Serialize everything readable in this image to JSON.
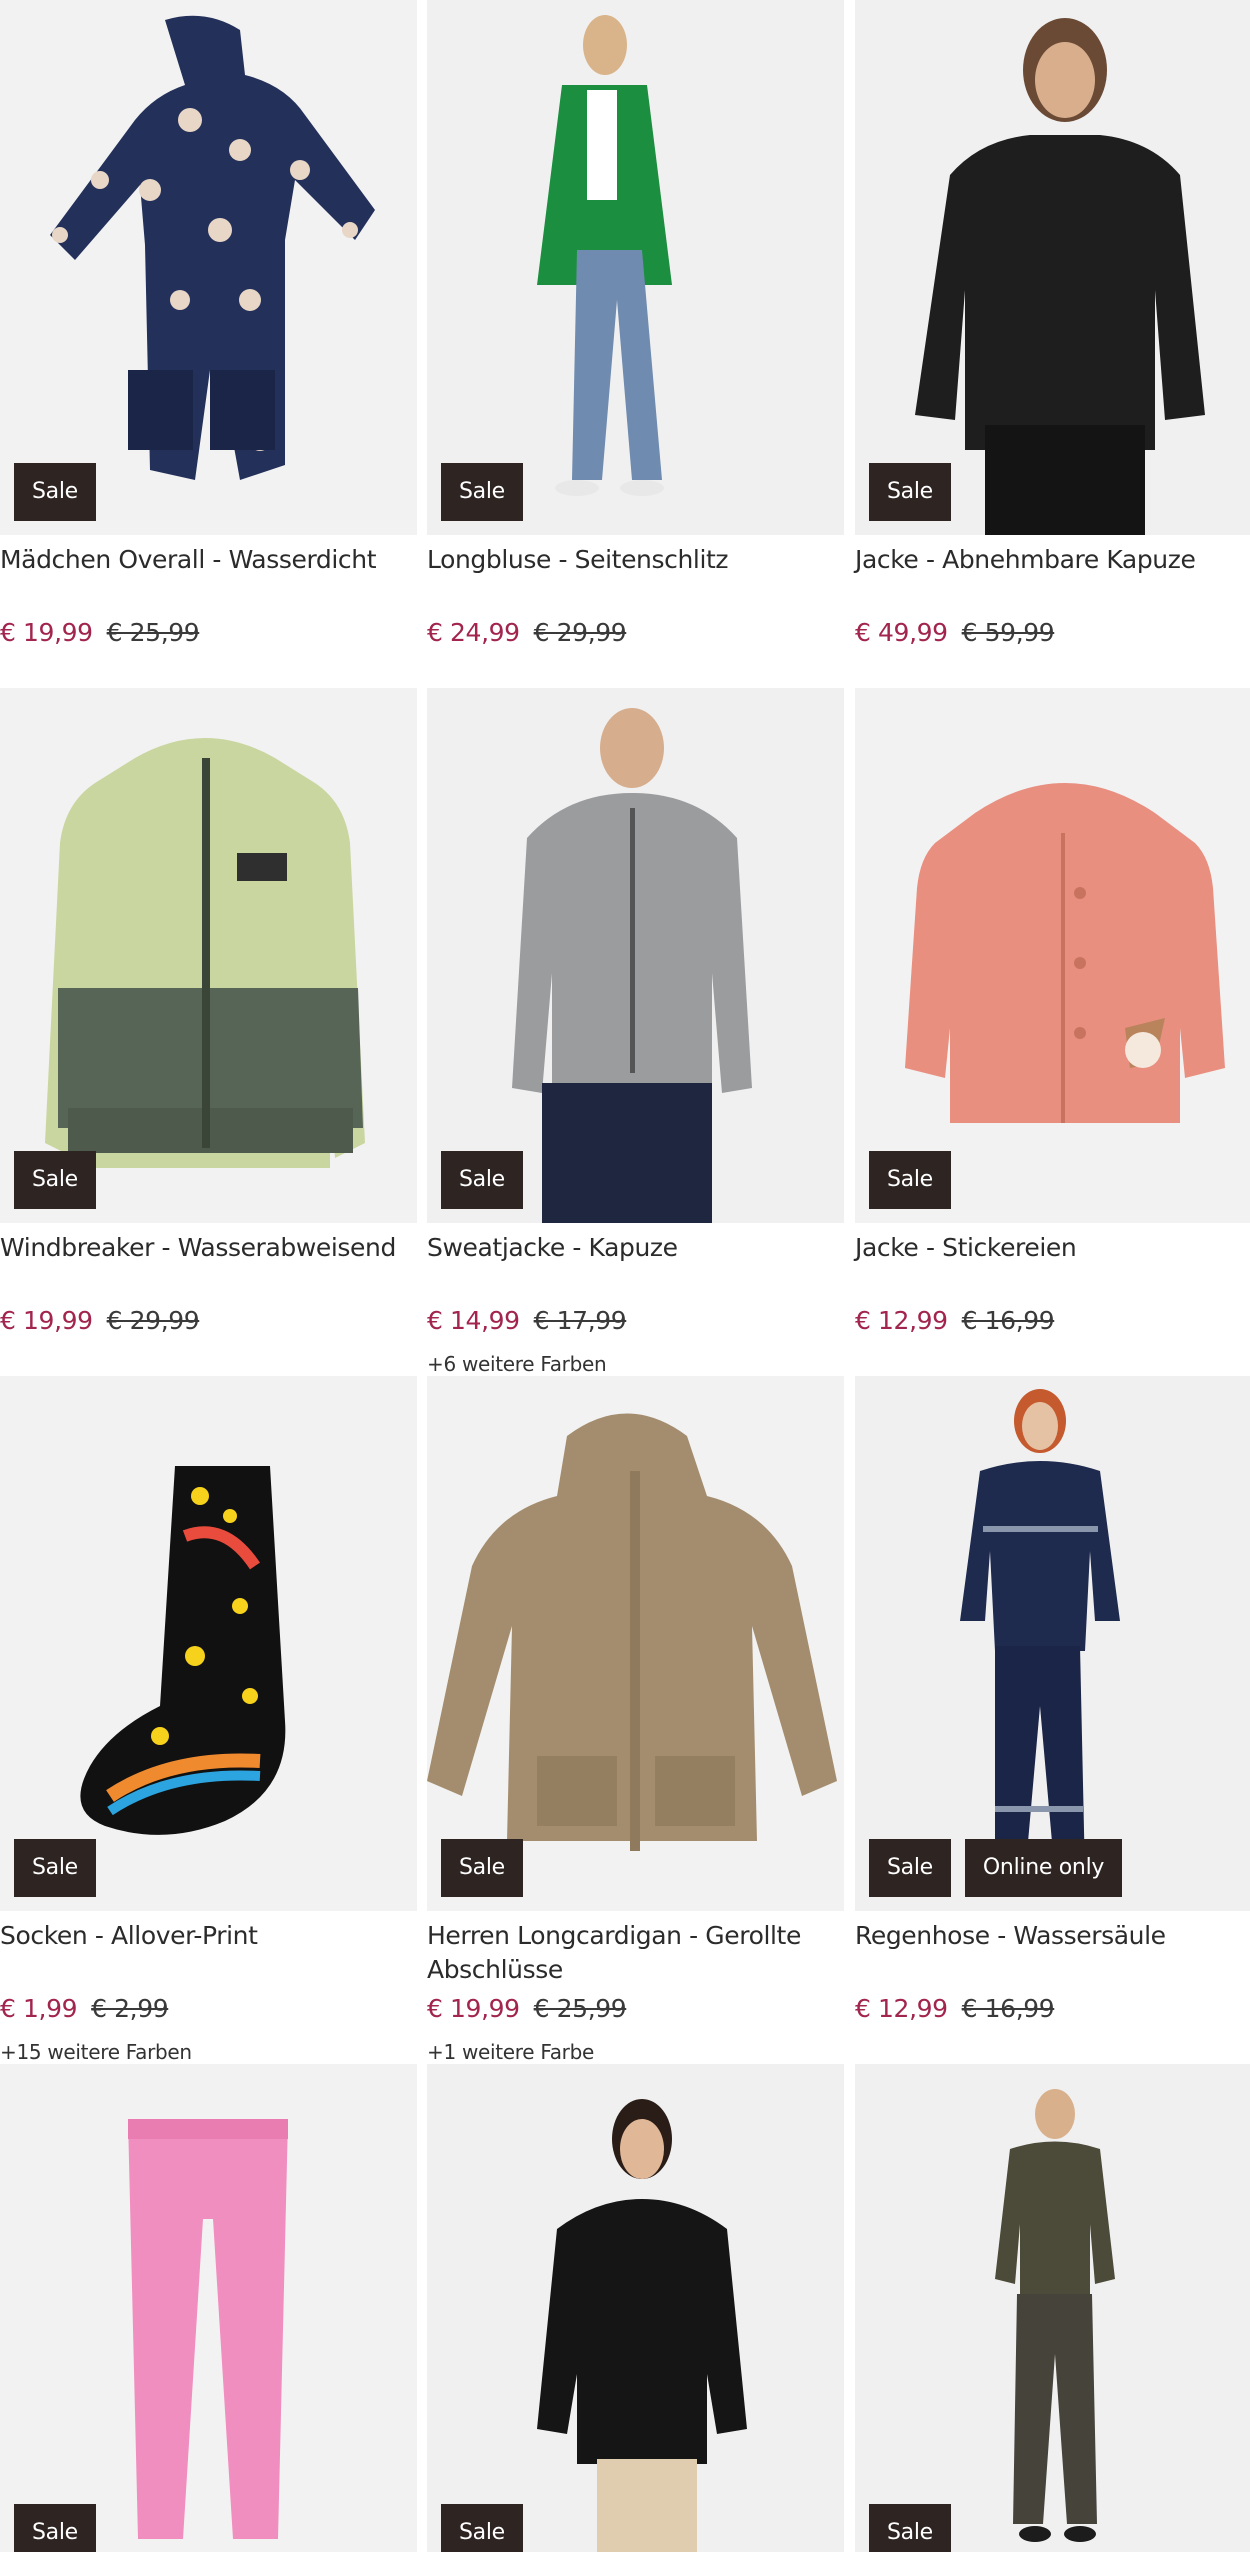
{
  "products": [
    {
      "title": "Mädchen Overall - Wasserdicht",
      "price": "€ 19,99",
      "old_price": "€ 25,99",
      "badges": [
        "Sale"
      ],
      "colors_text": "",
      "image_icon": "kids-overall-photo"
    },
    {
      "title": "Longbluse - Seitenschlitz",
      "price": "€ 24,99",
      "old_price": "€ 29,99",
      "badges": [
        "Sale"
      ],
      "colors_text": "",
      "image_icon": "model-green-blouse-photo"
    },
    {
      "title": "Jacke - Abnehmbare Kapuze",
      "price": "€ 49,99",
      "old_price": "€ 59,99",
      "badges": [
        "Sale"
      ],
      "colors_text": "",
      "image_icon": "model-black-jacket-photo"
    },
    {
      "title": "Windbreaker - Wasserabweisend",
      "price": "€ 19,99",
      "old_price": "€ 29,99",
      "badges": [
        "Sale"
      ],
      "colors_text": "",
      "image_icon": "windbreaker-photo"
    },
    {
      "title": "Sweatjacke - Kapuze",
      "price": "€ 14,99",
      "old_price": "€ 17,99",
      "badges": [
        "Sale"
      ],
      "colors_text": "+6 weitere Farben",
      "image_icon": "model-grey-hoodie-photo"
    },
    {
      "title": "Jacke - Stickereien",
      "price": "€ 12,99",
      "old_price": "€ 16,99",
      "badges": [
        "Sale"
      ],
      "colors_text": "",
      "image_icon": "baby-pink-knit-jacket-photo"
    },
    {
      "title": "Socken - Allover-Print",
      "price": "€ 1,99",
      "old_price": "€ 2,99",
      "badges": [
        "Sale"
      ],
      "colors_text": "+15 weitere Farben",
      "image_icon": "star-socks-photo"
    },
    {
      "title": "Herren Longcardigan - Gerollte Abschlüsse",
      "price": "€ 19,99",
      "old_price": "€ 25,99",
      "badges": [
        "Sale"
      ],
      "colors_text": "+1 weitere Farbe",
      "image_icon": "beige-cardigan-photo"
    },
    {
      "title": "Regenhose - Wassersäule",
      "price": "€ 12,99",
      "old_price": "€ 16,99",
      "badges": [
        "Sale",
        "Online only"
      ],
      "colors_text": "",
      "image_icon": "model-rainwear-photo"
    },
    {
      "title": "",
      "price": "",
      "old_price": "",
      "badges": [
        "Sale"
      ],
      "colors_text": "",
      "image_icon": "pink-leggings-photo"
    },
    {
      "title": "",
      "price": "",
      "old_price": "",
      "badges": [
        "Sale"
      ],
      "colors_text": "",
      "image_icon": "model-black-short-jacket-photo"
    },
    {
      "title": "",
      "price": "",
      "old_price": "",
      "badges": [
        "Sale"
      ],
      "colors_text": "",
      "image_icon": "model-olive-tracksuit-photo"
    }
  ],
  "colors": {
    "sale_price": "#a1254d",
    "badge_bg": "#2e2523",
    "photo_bg": "#f1f1f1"
  }
}
